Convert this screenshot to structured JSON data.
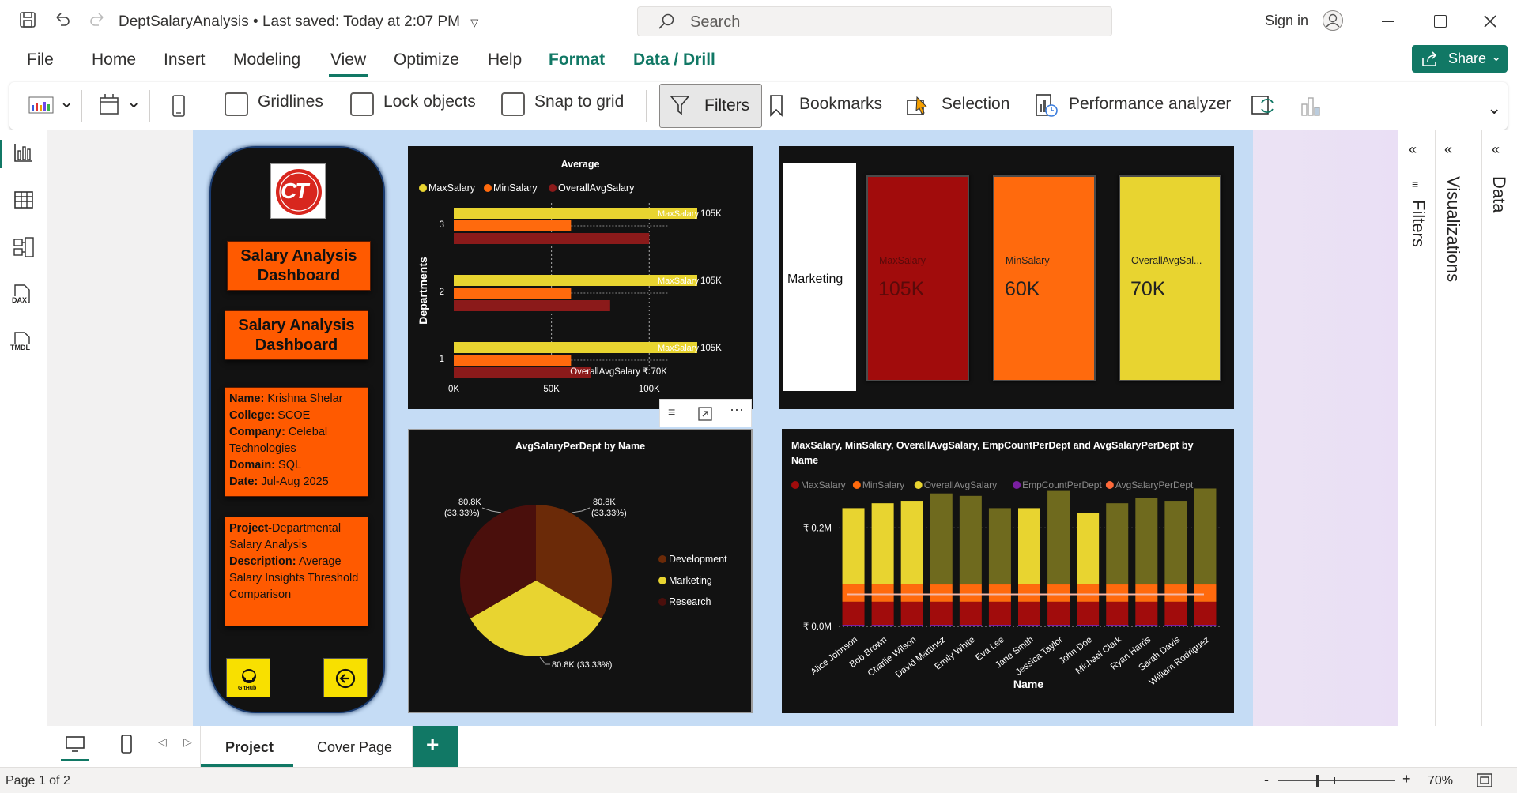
{
  "app": {
    "title": "DeptSalaryAnalysis",
    "saved": "• Last saved: Today at 2:07 PM",
    "search_placeholder": "Search",
    "sign_in": "Sign in"
  },
  "menu": [
    "File",
    "Home",
    "Insert",
    "Modeling",
    "View",
    "Optimize",
    "Help",
    "Format",
    "Data / Drill"
  ],
  "share": "Share",
  "ribbon": {
    "gridlines": "Gridlines",
    "lock_objects": "Lock objects",
    "snap_to_grid": "Snap to grid",
    "filters": "Filters",
    "bookmarks": "Bookmarks",
    "selection": "Selection",
    "performance_analyzer": "Performance analyzer"
  },
  "rail": {
    "dax": "DAX",
    "tmdl": "TMDL"
  },
  "panes": {
    "filters": "Filters",
    "visualizations": "Visualizations",
    "data": "Data"
  },
  "nav_panel": {
    "logo_text": "CT",
    "title1": "Salary Analysis Dashboard",
    "title2": "Salary Analysis Dashboard",
    "info": [
      {
        "k": "Name:",
        "v": " Krishna Shelar"
      },
      {
        "k": "College:",
        "v": " SCOE"
      },
      {
        "k": "Company:",
        "v": " Celebal Technologies"
      },
      {
        "k": "Domain:",
        "v": " SQL"
      },
      {
        "k": "Date:",
        "v": " Jul-Aug 2025"
      }
    ],
    "project": [
      {
        "k": "Project-",
        "v": "Departmental Salary Analysis"
      },
      {
        "k": "Description:",
        "v": " Average Salary Insights Threshold Comparison"
      }
    ],
    "github_label": "GitHub"
  },
  "cards": {
    "dept": "Marketing",
    "items": [
      {
        "label": "MaxSalary",
        "value": "105K",
        "color": "#a10c0c"
      },
      {
        "label": "MinSalary",
        "value": "60K",
        "color": "#ff6a0d"
      },
      {
        "label": "OverallAvgSal...",
        "value": "70K",
        "color": "#e8d430"
      }
    ]
  },
  "chart_data": [
    {
      "type": "bar",
      "orientation": "horizontal",
      "title": "Average",
      "ylabel": "Departments",
      "categories": [
        "3",
        "2",
        "1"
      ],
      "series": [
        {
          "name": "MaxSalary",
          "color": "#e8d430",
          "values": [
            105000,
            105000,
            105000
          ]
        },
        {
          "name": "MinSalary",
          "color": "#ff6a0d",
          "values": [
            60000,
            60000,
            60000
          ]
        },
        {
          "name": "OverallAvgSalary",
          "color": "#8b1a1a",
          "values": [
            100000,
            80000,
            70000
          ]
        }
      ],
      "data_labels": {
        "max": "MaxSalary",
        "max_value": "105K",
        "avg_label": "OverallAvgSalary ₹ 70K"
      },
      "ticks": [
        "0K",
        "50K",
        "100K"
      ],
      "xlim": [
        0,
        110000
      ]
    },
    {
      "type": "pie",
      "title": "AvgSalaryPerDept by Name",
      "slices": [
        {
          "name": "Development",
          "value": 80.8,
          "color": "#6b2a08",
          "label": "80.8K",
          "pct": "(33.33%)"
        },
        {
          "name": "Marketing",
          "value": 80.8,
          "color": "#e8d430",
          "label": "80.8K (33.33%)"
        },
        {
          "name": "Research",
          "value": 80.8,
          "color": "#4a0f0c",
          "label": "80.8K",
          "pct": "(33.33%)"
        }
      ]
    },
    {
      "type": "bar",
      "stacked": true,
      "title": "MaxSalary, MinSalary, OverallAvgSalary, EmpCountPerDept and AvgSalaryPerDept by Name",
      "xlabel": "Name",
      "legend": [
        {
          "name": "MaxSalary",
          "color": "#a10c0c"
        },
        {
          "name": "MinSalary",
          "color": "#ff6a0d"
        },
        {
          "name": "OverallAvgSalary",
          "color": "#e8d430"
        },
        {
          "name": "EmpCountPerDept",
          "color": "#7a1fa2"
        },
        {
          "name": "AvgSalaryPerDept",
          "color": "#ff6a3a"
        }
      ],
      "categories": [
        "Alice Johnson",
        "Bob Brown",
        "Charlie Wilson",
        "David Martinez",
        "Emily White",
        "Eva Lee",
        "Jane Smith",
        "Jessica Taylor",
        "John Doe",
        "Michael Clark",
        "Ryan Harris",
        "Sarah Davis",
        "William Rodriguez"
      ],
      "totals": [
        0.24,
        0.25,
        0.255,
        0.27,
        0.265,
        0.24,
        0.24,
        0.275,
        0.23,
        0.25,
        0.26,
        0.255,
        0.28
      ],
      "dark_top": [
        false,
        false,
        false,
        true,
        true,
        true,
        false,
        true,
        false,
        true,
        true,
        true,
        true
      ],
      "ticks": [
        "₹ 0.2M",
        "₹ 0.0M"
      ],
      "ylim": [
        0,
        0.3
      ]
    }
  ],
  "tabs": {
    "active": "Project",
    "other": "Cover Page",
    "add": "+"
  },
  "status": {
    "page": "Page 1 of 2",
    "zoom": "70%"
  }
}
